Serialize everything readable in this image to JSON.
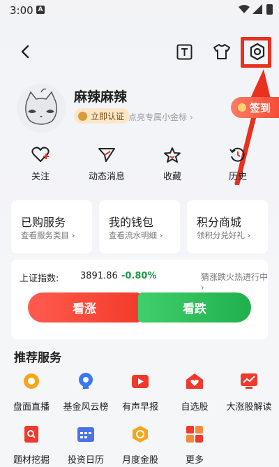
{
  "status_bar": {
    "time": "3:00",
    "notif_letter": "A"
  },
  "profile": {
    "username": "麻辣麻辣",
    "verify_label": "立即认证",
    "light_label": "点亮专属小金标 ›",
    "signin_label": "签到"
  },
  "quick_actions": [
    {
      "label": "关注",
      "icon": "heart-plus-icon"
    },
    {
      "label": "动态消息",
      "icon": "send-icon"
    },
    {
      "label": "收藏",
      "icon": "star-icon"
    },
    {
      "label": "历史",
      "icon": "history-icon"
    }
  ],
  "cards": [
    {
      "title": "已购服务",
      "subtitle": "查看服务类目 ›"
    },
    {
      "title": "我的钱包",
      "subtitle": "查看流水明细 ›"
    },
    {
      "title": "积分商城",
      "subtitle": "领积分兑好礼 ›"
    }
  ],
  "index": {
    "label": "上证指数:",
    "value": "3891.86",
    "change": "-0.80%",
    "guess_label": "猜涨跌火热进行中 ›",
    "up_label": "看涨",
    "down_label": "看跌"
  },
  "recommended": {
    "title": "推荐服务",
    "items": [
      {
        "label": "盘面直播",
        "icon": "live-icon",
        "color": "#f7a51c"
      },
      {
        "label": "基金风云榜",
        "icon": "trophy-icon",
        "color": "#3a78f0"
      },
      {
        "label": "有声早报",
        "icon": "play-icon",
        "color": "#f0392b"
      },
      {
        "label": "自选股",
        "icon": "heart-home-icon",
        "color": "#f0392b"
      },
      {
        "label": "大涨股解读",
        "icon": "trend-icon",
        "color": "#f0392b"
      },
      {
        "label": "题材挖掘",
        "icon": "magnifier-icon",
        "color": "#f0392b"
      },
      {
        "label": "投资日历",
        "icon": "calendar-icon",
        "color": "#4a72e8"
      },
      {
        "label": "月度金股",
        "icon": "gold-stock-icon",
        "color": "#f7a51c"
      },
      {
        "label": "更多",
        "icon": "grid-icon",
        "color": "#f0392b"
      }
    ]
  },
  "colors": {
    "accent": "#e8311f",
    "up": "#f33b2a",
    "down": "#21b04e"
  }
}
